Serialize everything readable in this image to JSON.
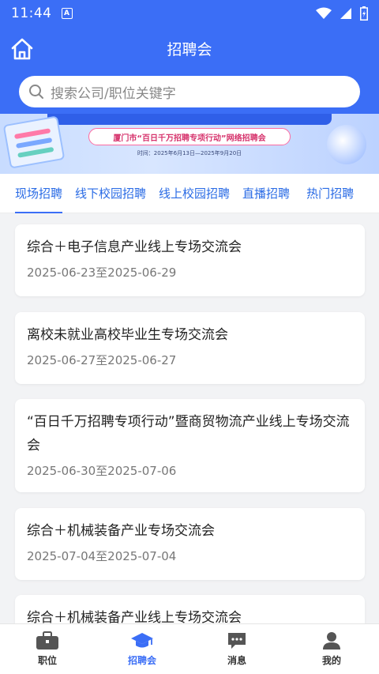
{
  "status_bar": {
    "time": "11:44",
    "badge": "A"
  },
  "header": {
    "title": "招聘会"
  },
  "search": {
    "placeholder": "搜索公司/职位关键字"
  },
  "banner": {
    "title": "厦门市“百日千万招聘专项行动”网络招聘会",
    "date": "时间：2025年6月13日—2025年9月20日"
  },
  "tabs": [
    {
      "label": "现场招聘"
    },
    {
      "label": "线下校园招聘"
    },
    {
      "label": "线上校园招聘"
    },
    {
      "label": "直播招聘"
    },
    {
      "label": "热门招聘"
    }
  ],
  "fairs": [
    {
      "title": "综合＋电子信息产业线上专场交流会",
      "date": "2025-06-23至2025-06-29"
    },
    {
      "title": "离校未就业高校毕业生专场交流会",
      "date": "2025-06-27至2025-06-27"
    },
    {
      "title": "“百日千万招聘专项行动”暨商贸物流产业线上专场交流会",
      "date": "2025-06-30至2025-07-06"
    },
    {
      "title": "综合＋机械装备产业专场交流会",
      "date": "2025-07-04至2025-07-04"
    },
    {
      "title": "综合＋机械装备产业线上专场交流会",
      "date": ""
    }
  ],
  "bottom_nav": [
    {
      "label": "职位",
      "icon": "briefcase-icon"
    },
    {
      "label": "招聘会",
      "icon": "graduation-cap-icon"
    },
    {
      "label": "消息",
      "icon": "message-icon"
    },
    {
      "label": "我的",
      "icon": "user-icon"
    }
  ],
  "colors": {
    "primary": "#3b6ef6",
    "tab_text": "#2a6be5",
    "background": "#f2f3f5"
  }
}
